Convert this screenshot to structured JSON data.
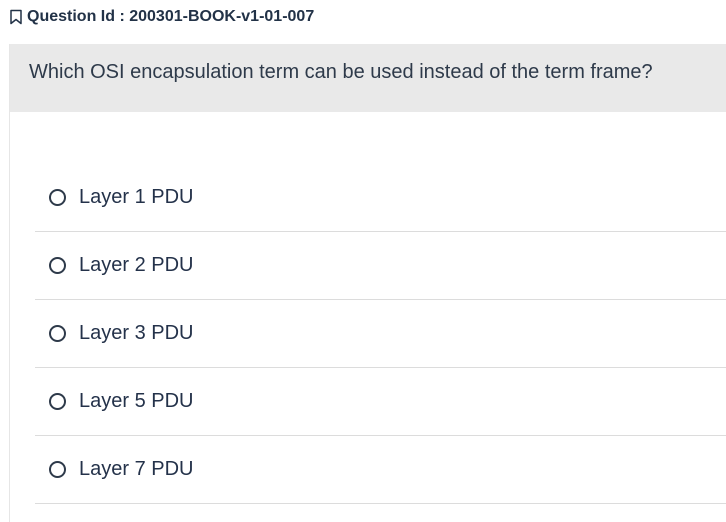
{
  "header": {
    "question_id_text": "Question Id : 200301-BOOK-v1-01-007"
  },
  "question": {
    "text": "Which OSI encapsulation term can be used instead of the term frame?"
  },
  "options": [
    {
      "label": "Layer 1 PDU"
    },
    {
      "label": "Layer 2 PDU"
    },
    {
      "label": "Layer 3 PDU"
    },
    {
      "label": "Layer 5 PDU"
    },
    {
      "label": "Layer 7 PDU"
    }
  ],
  "colors": {
    "question_background": "#e9e9e9",
    "text": "#2e3a4a",
    "divider": "#dcdcdc"
  }
}
